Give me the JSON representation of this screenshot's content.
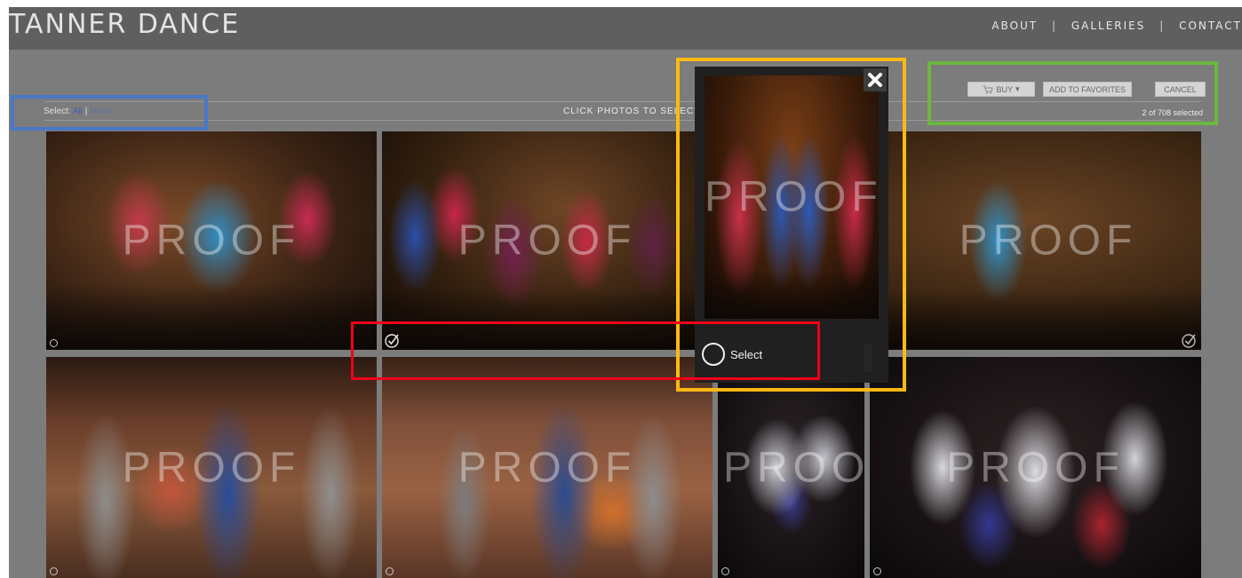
{
  "header": {
    "logo": "TANNER DANCE",
    "nav": [
      {
        "label": "ABOUT"
      },
      {
        "label": "GALLERIES"
      },
      {
        "label": "CONTACT"
      }
    ],
    "separator": "|"
  },
  "toolbar": {
    "select_label": "Select:",
    "select_all": "All",
    "select_sep": "|",
    "select_none": "None",
    "instruction": "CLICK PHOTOS TO SELECT",
    "buy_label": "BUY",
    "buy_caret": "▾",
    "add_favorites_label": "ADD TO FAVORITES",
    "cancel_label": "CANCEL",
    "selection_count": "2 of 708 selected"
  },
  "watermark": "PROOF",
  "overlay": {
    "select_label": "Select",
    "close_glyph": "✕"
  },
  "photos": [
    {
      "id": "dance-red-blue-1",
      "selected": false
    },
    {
      "id": "dance-group-purple",
      "selected": true
    },
    {
      "id": "dance-pose-pink-blue",
      "selected": true
    },
    {
      "id": "dance-solo-blue",
      "selected": true
    },
    {
      "id": "dance-finale-group-1",
      "selected": false
    },
    {
      "id": "dance-finale-group-2",
      "selected": false
    },
    {
      "id": "dance-folk-small",
      "selected": false
    },
    {
      "id": "dance-folk-group",
      "selected": false
    }
  ],
  "colors": {
    "page_bg": "#7c7c7c",
    "header_bg": "#5f5f5f",
    "annotation_blue": "#4a78c7",
    "annotation_yellow": "#fdb913",
    "annotation_green": "#6cb83d",
    "annotation_red": "#f0001a"
  }
}
